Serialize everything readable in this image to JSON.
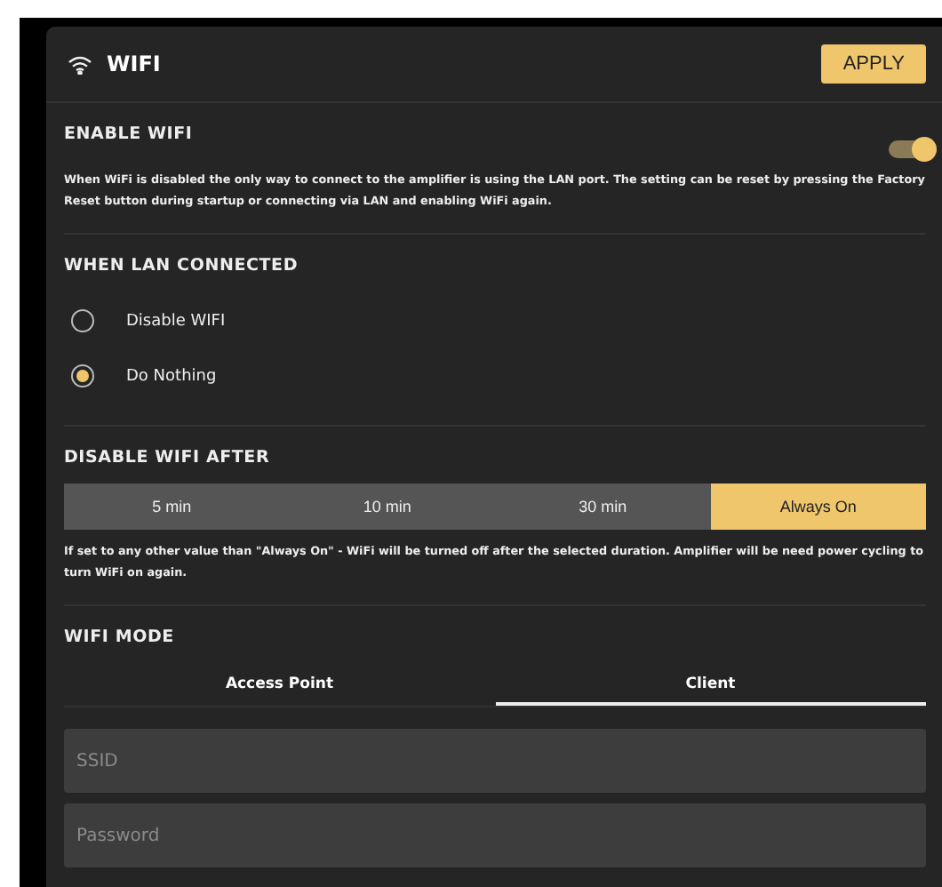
{
  "header": {
    "title": "WIFI",
    "apply_button": "APPLY"
  },
  "enable_wifi": {
    "heading": "ENABLE WIFI",
    "on": true,
    "description": "When WiFi is disabled the only way to connect to the amplifier is using the LAN port. The setting can be reset by pressing the Factory Reset button during startup or connecting via LAN and enabling WiFi again."
  },
  "when_lan_connected": {
    "heading": "WHEN LAN CONNECTED",
    "options": [
      {
        "label": "Disable WIFI",
        "selected": false
      },
      {
        "label": "Do Nothing",
        "selected": true
      }
    ]
  },
  "disable_wifi_after": {
    "heading": "DISABLE WIFI AFTER",
    "options": [
      {
        "label": "5 min",
        "selected": false
      },
      {
        "label": "10 min",
        "selected": false
      },
      {
        "label": "30 min",
        "selected": false
      },
      {
        "label": "Always On",
        "selected": true
      }
    ],
    "note": "If set to any other value than \"Always On\" - WiFi will be turned off after the selected duration. Amplifier will be need power cycling to turn WiFi on again."
  },
  "wifi_mode": {
    "heading": "WIFI MODE",
    "tabs": [
      {
        "label": "Access Point",
        "selected": false
      },
      {
        "label": "Client",
        "selected": true
      }
    ],
    "fields": [
      {
        "placeholder": "SSID"
      },
      {
        "placeholder": "Password"
      }
    ]
  }
}
